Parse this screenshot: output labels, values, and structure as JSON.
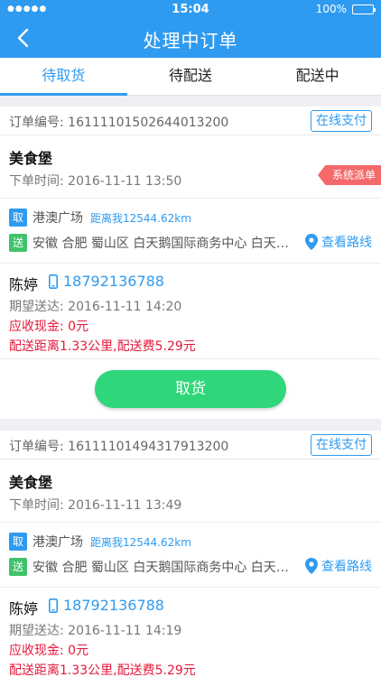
{
  "status_bar": {
    "signal": "●●●●●",
    "time": "15:04",
    "battery": "100%"
  },
  "nav": {
    "title": "处理中订单"
  },
  "tabs": [
    {
      "label": "待取货",
      "active": true
    },
    {
      "label": "待配送",
      "active": false
    },
    {
      "label": "配送中",
      "active": false
    }
  ],
  "orders": [
    {
      "order_no": "订单编号: 16111101502644013200",
      "pay_type": "在线支付",
      "shop_name": "美食堡",
      "order_time": "下单时间: 2016-11-11 13:50",
      "tag": "系统派单",
      "pick_icon": "取",
      "pick_name": "港澳广场",
      "distance": "距离我12544.62km",
      "drop_icon": "送",
      "drop_addr": "安徽 合肥 蜀山区 白天鹅国际商务中心 白天鹅国际商务中心",
      "route_link": "查看路线",
      "receiver": "陈婷",
      "phone": "18792136788",
      "expected": "期望送达: 2016-11-11 14:20",
      "cash": "应收现金: 0元",
      "fee": "配送距离1.33公里,配送费5.29元",
      "action": "取货"
    },
    {
      "order_no": "订单编号: 16111101494317913200",
      "pay_type": "在线支付",
      "shop_name": "美食堡",
      "order_time": "下单时间: 2016-11-11 13:49",
      "pick_icon": "取",
      "pick_name": "港澳广场",
      "distance": "距离我12544.62km",
      "drop_icon": "送",
      "drop_addr": "安徽 合肥 蜀山区 白天鹅国际商务中心 白天鹅国际商务中心",
      "route_link": "查看路线",
      "receiver": "陈婷",
      "phone": "18792136788",
      "expected": "期望送达: 2016-11-11 14:19",
      "cash": "应收现金: 0元",
      "fee": "配送距离1.33公里,配送费5.29元"
    }
  ],
  "colors": {
    "primary": "#2f9bf0",
    "action": "#2fd67a",
    "alert": "#e5183a",
    "tag": "#f46a6a",
    "drop": "#3fc36b"
  }
}
